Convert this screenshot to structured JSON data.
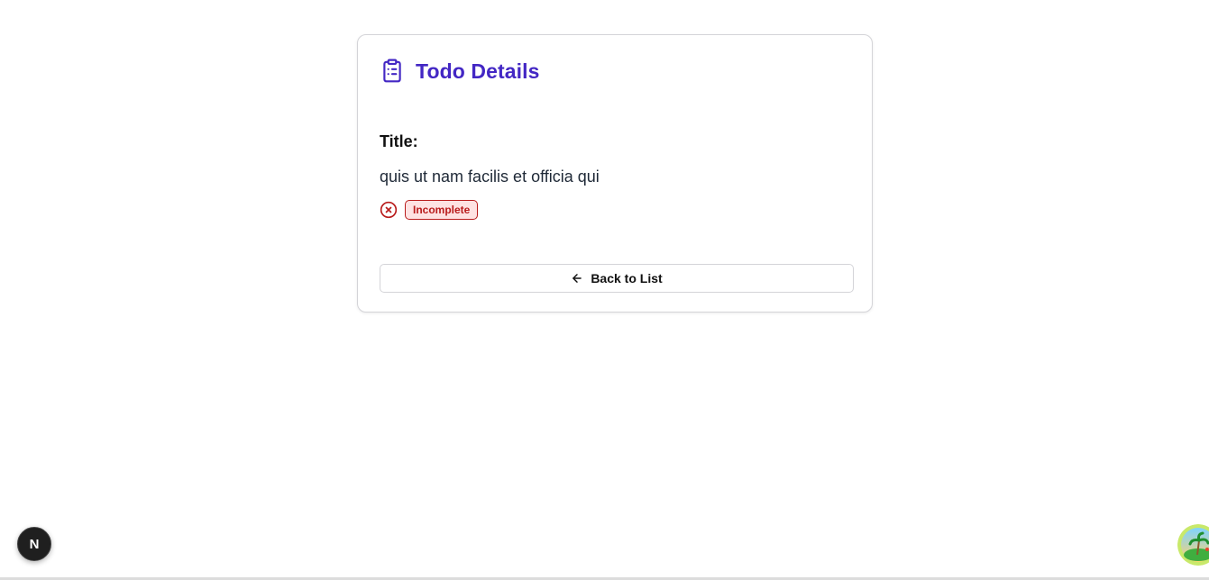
{
  "card": {
    "heading": "Todo Details",
    "heading_icon": "clipboard-list-icon",
    "title_label": "Title:",
    "title_value": "quis ut nam facilis et officia qui",
    "status": {
      "icon": "x-circle-icon",
      "label": "Incomplete",
      "color": "#b91c1c"
    },
    "back_button": {
      "icon": "arrow-left-icon",
      "label": "Back to List"
    }
  },
  "dev_badge": {
    "label": "N"
  },
  "colors": {
    "accent": "#4327c4",
    "danger": "#b91c1c",
    "danger_bg": "#fee2e2",
    "border": "#d4d4d8"
  }
}
